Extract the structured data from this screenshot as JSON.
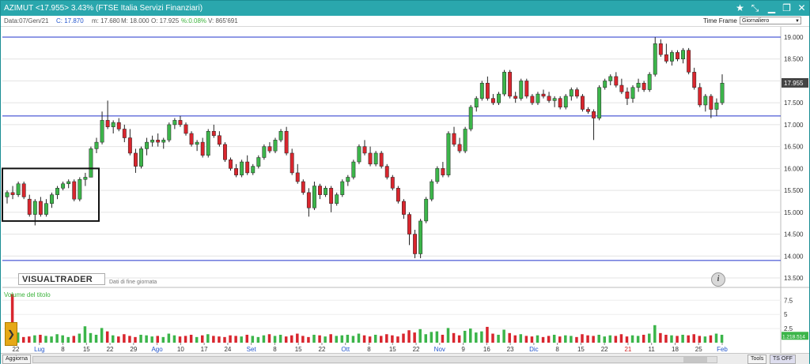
{
  "window": {
    "title": "AZIMUT <17.955> 3.43%  (FTSE Italia Servizi Finanziari)"
  },
  "info": {
    "date": "Data:07/Gen/21",
    "close": "C: 17.870",
    "min": "m: 17.680",
    "max": "M: 18.000",
    "open": "O: 17.925",
    "pct": "%:0.08%",
    "vol": "V: 865'691"
  },
  "timeframe": {
    "label": "Time Frame",
    "value": "Giornaliero"
  },
  "logo": "VISUALTRADER",
  "logo_sub": "Dati di fine giornata",
  "volume_label": "Volume del titolo",
  "price_axis": [
    "19.000",
    "18.500",
    "18.000",
    "17.500",
    "17.000",
    "16.500",
    "16.000",
    "15.500",
    "15.000",
    "14.500",
    "14.000",
    "13.500"
  ],
  "current_price": "17.955",
  "volume_axis": [
    "7.5",
    "5",
    "2.5"
  ],
  "volume_current": "1.218.514",
  "date_axis": [
    {
      "t": "22",
      "c": "#333333"
    },
    {
      "t": "Lug",
      "c": "#2255cc"
    },
    {
      "t": "8",
      "c": "#333333"
    },
    {
      "t": "15",
      "c": "#333333"
    },
    {
      "t": "22",
      "c": "#333333"
    },
    {
      "t": "29",
      "c": "#333333"
    },
    {
      "t": "Ago",
      "c": "#2255cc"
    },
    {
      "t": "10",
      "c": "#333333"
    },
    {
      "t": "17",
      "c": "#333333"
    },
    {
      "t": "24",
      "c": "#333333"
    },
    {
      "t": "Set",
      "c": "#2255cc"
    },
    {
      "t": "8",
      "c": "#333333"
    },
    {
      "t": "15",
      "c": "#333333"
    },
    {
      "t": "22",
      "c": "#333333"
    },
    {
      "t": "Ott",
      "c": "#2255cc"
    },
    {
      "t": "8",
      "c": "#333333"
    },
    {
      "t": "15",
      "c": "#333333"
    },
    {
      "t": "22",
      "c": "#333333"
    },
    {
      "t": "Nov",
      "c": "#2255cc"
    },
    {
      "t": "9",
      "c": "#333333"
    },
    {
      "t": "16",
      "c": "#333333"
    },
    {
      "t": "23",
      "c": "#333333"
    },
    {
      "t": "Dic",
      "c": "#2255cc"
    },
    {
      "t": "8",
      "c": "#333333"
    },
    {
      "t": "15",
      "c": "#333333"
    },
    {
      "t": "22",
      "c": "#333333"
    },
    {
      "t": "21",
      "c": "#cc2222"
    },
    {
      "t": "11",
      "c": "#333333"
    },
    {
      "t": "18",
      "c": "#333333"
    },
    {
      "t": "25",
      "c": "#333333"
    },
    {
      "t": "Feb",
      "c": "#2255cc"
    }
  ],
  "bottom": {
    "update": "Aggiorna",
    "tools": "Tools",
    "ts": "TS OFF"
  },
  "colors": {
    "up": "#3cb54a",
    "down": "#d9262e",
    "level_line": "#2233cc",
    "accent": "#2aa7ad"
  },
  "chart_data": {
    "type": "candlestick",
    "y_range": [
      13.5,
      19.0
    ],
    "horizontal_levels": [
      19.0,
      17.2,
      13.9
    ],
    "candles": [
      [
        15.35,
        15.5,
        15.2,
        15.45
      ],
      [
        15.45,
        15.6,
        15.3,
        15.4
      ],
      [
        15.4,
        15.7,
        15.35,
        15.65
      ],
      [
        15.65,
        15.7,
        15.3,
        15.35
      ],
      [
        15.3,
        15.4,
        14.9,
        14.95
      ],
      [
        14.95,
        15.3,
        14.7,
        15.25
      ],
      [
        15.25,
        15.35,
        14.9,
        14.95
      ],
      [
        14.95,
        15.3,
        14.9,
        15.2
      ],
      [
        15.2,
        15.45,
        15.1,
        15.4
      ],
      [
        15.4,
        15.6,
        15.3,
        15.55
      ],
      [
        15.55,
        15.7,
        15.5,
        15.65
      ],
      [
        15.65,
        15.75,
        15.55,
        15.7
      ],
      [
        15.7,
        15.75,
        15.25,
        15.3
      ],
      [
        15.3,
        15.8,
        15.25,
        15.75
      ],
      [
        15.75,
        15.9,
        15.6,
        15.8
      ],
      [
        15.8,
        16.5,
        15.8,
        16.45
      ],
      [
        16.45,
        16.7,
        16.35,
        16.6
      ],
      [
        16.6,
        17.3,
        16.55,
        17.1
      ],
      [
        17.1,
        17.55,
        16.9,
        16.95
      ],
      [
        16.95,
        17.1,
        16.8,
        17.05
      ],
      [
        17.05,
        17.15,
        16.85,
        16.9
      ],
      [
        16.9,
        17.0,
        16.6,
        16.7
      ],
      [
        16.7,
        16.9,
        16.3,
        16.35
      ],
      [
        16.35,
        16.45,
        15.9,
        16.05
      ],
      [
        16.05,
        16.5,
        16.0,
        16.45
      ],
      [
        16.45,
        16.7,
        16.3,
        16.6
      ],
      [
        16.6,
        16.75,
        16.5,
        16.65
      ],
      [
        16.65,
        16.8,
        16.5,
        16.6
      ],
      [
        16.6,
        16.7,
        16.45,
        16.65
      ],
      [
        16.65,
        17.05,
        16.6,
        17.0
      ],
      [
        17.0,
        17.15,
        16.9,
        17.1
      ],
      [
        17.1,
        17.2,
        16.95,
        17.0
      ],
      [
        17.0,
        17.05,
        16.75,
        16.8
      ],
      [
        16.8,
        16.85,
        16.5,
        16.55
      ],
      [
        16.55,
        16.65,
        16.4,
        16.6
      ],
      [
        16.6,
        16.7,
        16.25,
        16.3
      ],
      [
        16.3,
        16.9,
        16.25,
        16.85
      ],
      [
        16.85,
        17.0,
        16.7,
        16.75
      ],
      [
        16.75,
        16.85,
        16.5,
        16.55
      ],
      [
        16.55,
        16.6,
        16.15,
        16.2
      ],
      [
        16.2,
        16.25,
        15.95,
        16.0
      ],
      [
        16.0,
        16.1,
        15.8,
        15.85
      ],
      [
        15.85,
        16.2,
        15.8,
        16.15
      ],
      [
        16.15,
        16.3,
        15.85,
        15.9
      ],
      [
        15.9,
        16.1,
        15.85,
        16.05
      ],
      [
        16.05,
        16.3,
        16.0,
        16.25
      ],
      [
        16.25,
        16.55,
        16.2,
        16.5
      ],
      [
        16.5,
        16.6,
        16.35,
        16.4
      ],
      [
        16.4,
        16.7,
        16.35,
        16.65
      ],
      [
        16.65,
        16.9,
        16.6,
        16.85
      ],
      [
        16.85,
        16.95,
        16.3,
        16.35
      ],
      [
        16.35,
        16.45,
        15.85,
        15.9
      ],
      [
        15.9,
        16.1,
        15.65,
        15.7
      ],
      [
        15.7,
        15.75,
        15.4,
        15.45
      ],
      [
        15.45,
        15.55,
        14.9,
        15.1
      ],
      [
        15.1,
        15.7,
        15.05,
        15.6
      ],
      [
        15.6,
        15.65,
        15.3,
        15.4
      ],
      [
        15.4,
        15.6,
        15.35,
        15.55
      ],
      [
        15.55,
        15.6,
        15.0,
        15.2
      ],
      [
        15.2,
        15.45,
        15.15,
        15.4
      ],
      [
        15.4,
        15.75,
        15.35,
        15.7
      ],
      [
        15.7,
        15.85,
        15.6,
        15.8
      ],
      [
        15.8,
        16.2,
        15.75,
        16.15
      ],
      [
        16.15,
        16.55,
        16.1,
        16.5
      ],
      [
        16.5,
        16.65,
        16.3,
        16.35
      ],
      [
        16.35,
        16.5,
        16.05,
        16.1
      ],
      [
        16.1,
        16.4,
        16.05,
        16.35
      ],
      [
        16.35,
        16.4,
        16.0,
        16.05
      ],
      [
        16.05,
        16.1,
        15.75,
        15.8
      ],
      [
        15.8,
        15.85,
        15.5,
        15.55
      ],
      [
        15.55,
        15.6,
        15.2,
        15.25
      ],
      [
        15.25,
        15.3,
        14.85,
        14.95
      ],
      [
        14.95,
        15.0,
        14.25,
        14.5
      ],
      [
        14.5,
        14.6,
        13.95,
        14.05
      ],
      [
        14.05,
        14.85,
        13.95,
        14.8
      ],
      [
        14.8,
        15.35,
        14.75,
        15.3
      ],
      [
        15.3,
        15.75,
        15.25,
        15.7
      ],
      [
        15.7,
        16.05,
        15.65,
        16.0
      ],
      [
        16.0,
        16.15,
        15.8,
        15.85
      ],
      [
        15.85,
        16.85,
        15.8,
        16.8
      ],
      [
        16.8,
        16.95,
        16.5,
        16.55
      ],
      [
        16.55,
        16.7,
        16.35,
        16.4
      ],
      [
        16.4,
        16.95,
        16.35,
        16.9
      ],
      [
        16.9,
        17.45,
        16.85,
        17.4
      ],
      [
        17.4,
        17.65,
        17.3,
        17.6
      ],
      [
        17.6,
        18.0,
        17.55,
        17.95
      ],
      [
        17.95,
        18.1,
        17.55,
        17.6
      ],
      [
        17.6,
        17.7,
        17.45,
        17.5
      ],
      [
        17.5,
        17.75,
        17.45,
        17.7
      ],
      [
        17.7,
        18.25,
        17.65,
        18.2
      ],
      [
        18.2,
        18.25,
        17.6,
        17.65
      ],
      [
        17.65,
        17.75,
        17.5,
        17.6
      ],
      [
        17.6,
        18.05,
        17.55,
        18.0
      ],
      [
        18.0,
        18.05,
        17.6,
        17.65
      ],
      [
        17.65,
        17.7,
        17.45,
        17.5
      ],
      [
        17.5,
        17.75,
        17.45,
        17.7
      ],
      [
        17.7,
        17.8,
        17.6,
        17.65
      ],
      [
        17.65,
        17.75,
        17.5,
        17.55
      ],
      [
        17.55,
        17.65,
        17.4,
        17.6
      ],
      [
        17.6,
        17.65,
        17.35,
        17.4
      ],
      [
        17.4,
        17.7,
        17.35,
        17.65
      ],
      [
        17.65,
        17.85,
        17.55,
        17.8
      ],
      [
        17.8,
        17.85,
        17.6,
        17.65
      ],
      [
        17.65,
        17.7,
        17.3,
        17.35
      ],
      [
        17.35,
        17.4,
        17.25,
        17.3
      ],
      [
        17.3,
        17.35,
        16.65,
        17.15
      ],
      [
        17.15,
        17.9,
        17.1,
        17.85
      ],
      [
        17.85,
        18.05,
        17.8,
        18.0
      ],
      [
        18.0,
        18.15,
        17.9,
        18.1
      ],
      [
        18.1,
        18.2,
        17.85,
        17.9
      ],
      [
        17.9,
        18.05,
        17.7,
        17.75
      ],
      [
        17.75,
        17.85,
        17.45,
        17.6
      ],
      [
        17.6,
        17.9,
        17.5,
        17.85
      ],
      [
        17.85,
        18.05,
        17.75,
        17.95
      ],
      [
        17.95,
        18.0,
        17.75,
        17.8
      ],
      [
        17.8,
        18.2,
        17.75,
        18.15
      ],
      [
        18.15,
        19.0,
        18.1,
        18.85
      ],
      [
        18.85,
        18.95,
        18.55,
        18.6
      ],
      [
        18.6,
        18.85,
        18.4,
        18.45
      ],
      [
        18.45,
        18.7,
        18.35,
        18.65
      ],
      [
        18.65,
        18.7,
        18.45,
        18.5
      ],
      [
        18.5,
        18.75,
        18.4,
        18.7
      ],
      [
        18.7,
        18.75,
        18.15,
        18.2
      ],
      [
        18.2,
        18.3,
        17.8,
        17.85
      ],
      [
        17.85,
        17.95,
        17.4,
        17.45
      ],
      [
        17.45,
        17.7,
        17.3,
        17.65
      ],
      [
        17.65,
        17.7,
        17.15,
        17.35
      ],
      [
        17.35,
        17.6,
        17.2,
        17.5
      ],
      [
        17.5,
        18.15,
        17.45,
        17.95
      ]
    ],
    "volumes": [
      1.2,
      8.6,
      1.8,
      1.0,
      1.1,
      1.3,
      1.4,
      1.2,
      1.1,
      1.5,
      1.3,
      1.0,
      1.2,
      1.6,
      2.9,
      1.7,
      1.4,
      2.6,
      2.0,
      1.3,
      1.1,
      1.5,
      1.2,
      1.0,
      1.4,
      1.3,
      1.1,
      1.2,
      1.0,
      1.6,
      1.3,
      1.1,
      1.2,
      1.4,
      1.0,
      1.3,
      1.5,
      1.2,
      1.1,
      1.0,
      1.3,
      1.2,
      1.1,
      1.4,
      1.2,
      1.0,
      1.3,
      1.5,
      1.2,
      1.4,
      1.1,
      1.3,
      1.6,
      1.2,
      1.0,
      1.4,
      1.3,
      1.1,
      1.5,
      1.2,
      1.3,
      1.4,
      1.2,
      1.6,
      1.3,
      1.1,
      1.4,
      1.2,
      1.5,
      1.3,
      1.1,
      1.6,
      2.2,
      1.8,
      2.4,
      1.5,
      1.9,
      2.0,
      1.4,
      2.6,
      1.7,
      1.3,
      2.1,
      2.5,
      1.8,
      2.0,
      2.8,
      1.6,
      1.4,
      2.3,
      1.7,
      1.3,
      1.5,
      1.2,
      1.1,
      1.3,
      1.0,
      1.2,
      1.4,
      1.1,
      1.3,
      1.2,
      1.0,
      1.5,
      1.3,
      1.2,
      1.4,
      1.1,
      1.3,
      1.2,
      1.5,
      1.1,
      1.3,
      1.2,
      1.4,
      1.6,
      3.1,
      1.7,
      1.4,
      1.3,
      1.2,
      1.4,
      1.3,
      1.5,
      1.2,
      1.1,
      1.3,
      1.6,
      1.4
    ]
  }
}
